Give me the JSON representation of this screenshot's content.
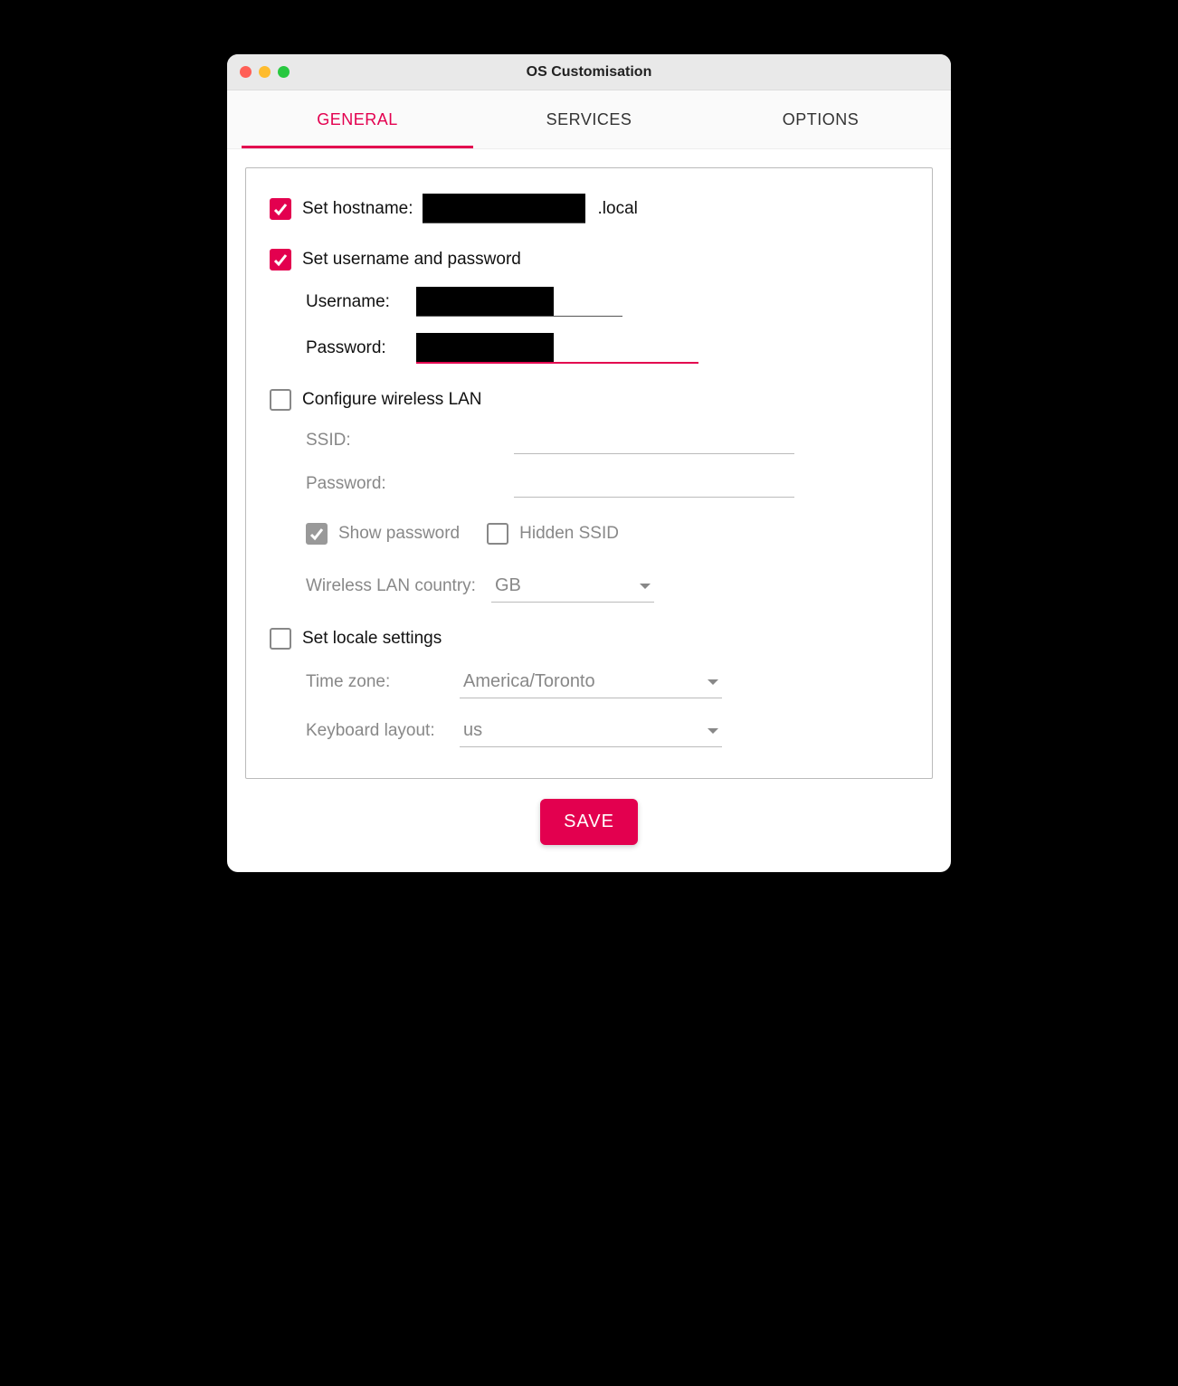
{
  "window": {
    "title": "OS Customisation"
  },
  "tabs": {
    "general": "GENERAL",
    "services": "SERVICES",
    "options": "OPTIONS"
  },
  "hostname": {
    "label": "Set hostname:",
    "suffix": ".local"
  },
  "userpass": {
    "label": "Set username and password",
    "username_label": "Username:",
    "password_label": "Password:"
  },
  "wlan": {
    "label": "Configure wireless LAN",
    "ssid_label": "SSID:",
    "password_label": "Password:",
    "show_password": "Show password",
    "hidden_ssid": "Hidden SSID",
    "country_label": "Wireless LAN country:",
    "country_value": "GB"
  },
  "locale": {
    "label": "Set locale settings",
    "tz_label": "Time zone:",
    "tz_value": "America/Toronto",
    "kb_label": "Keyboard layout:",
    "kb_value": "us"
  },
  "buttons": {
    "save": "SAVE"
  }
}
